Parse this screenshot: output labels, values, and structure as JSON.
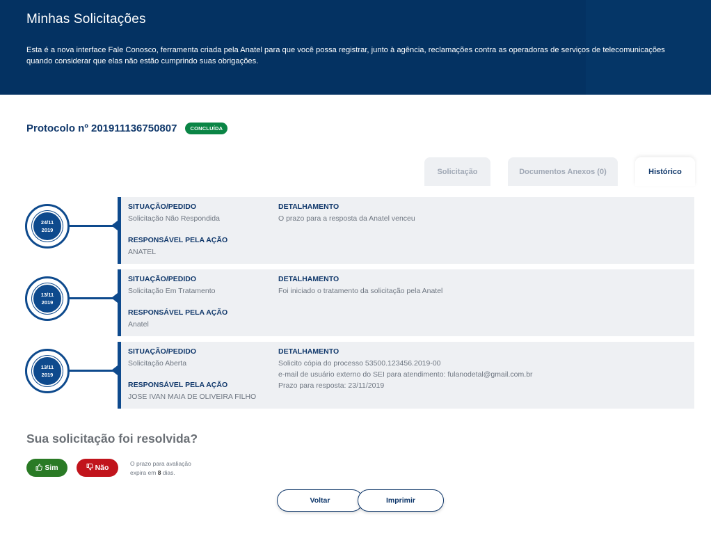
{
  "header": {
    "title": "Minhas Solicitações",
    "description": "Esta é a nova interface Fale Conosco, ferramenta criada pela Anatel para que você possa registrar, junto à agência, reclamações contra as operadoras de serviços de telecomunicações quando considerar que elas não estão cumprindo suas obrigações."
  },
  "protocol": {
    "label": "Protocolo nº 201911136750807",
    "status": "CONCLUÍDA",
    "status_color": "#0a8545"
  },
  "tabs": [
    {
      "label": "Solicitação",
      "active": false
    },
    {
      "label": "Documentos Anexos (0)",
      "active": false
    },
    {
      "label": "Histórico",
      "active": true
    }
  ],
  "labels": {
    "situacao": "SITUAÇÃO/PEDIDO",
    "detalhamento": "DETALHAMENTO",
    "responsavel": "RESPONSÁVEL PELA AÇÃO"
  },
  "history": [
    {
      "day": "24/11",
      "year": "2019",
      "situacao": "Solicitação Não Respondida",
      "responsavel": "ANATEL",
      "detalhamento": [
        "O prazo para a resposta da Anatel venceu"
      ]
    },
    {
      "day": "13/11",
      "year": "2019",
      "situacao": "Solicitação Em Tratamento",
      "responsavel": "Anatel",
      "detalhamento": [
        "Foi iniciado o tratamento da solicitação pela Anatel"
      ]
    },
    {
      "day": "13/11",
      "year": "2019",
      "situacao": "Solicitação Aberta",
      "responsavel": "JOSE IVAN MAIA DE OLIVEIRA FILHO",
      "detalhamento": [
        "Solicito cópia do processo 53500.123456.2019-00",
        "e-mail de usuário externo do SEI para atendimento: fulanodetal@gmail.com.br",
        "Prazo para resposta: 23/11/2019"
      ]
    }
  ],
  "feedback": {
    "question": "Sua solicitação foi resolvida?",
    "yes_label": "Sim",
    "no_label": "Não",
    "prazo_line1": "O prazo para avaliação",
    "prazo_prefix": "expira em",
    "prazo_days": "8",
    "prazo_suffix": "dias."
  },
  "actions": {
    "back_label": "Voltar",
    "print_label": "Imprimir"
  }
}
